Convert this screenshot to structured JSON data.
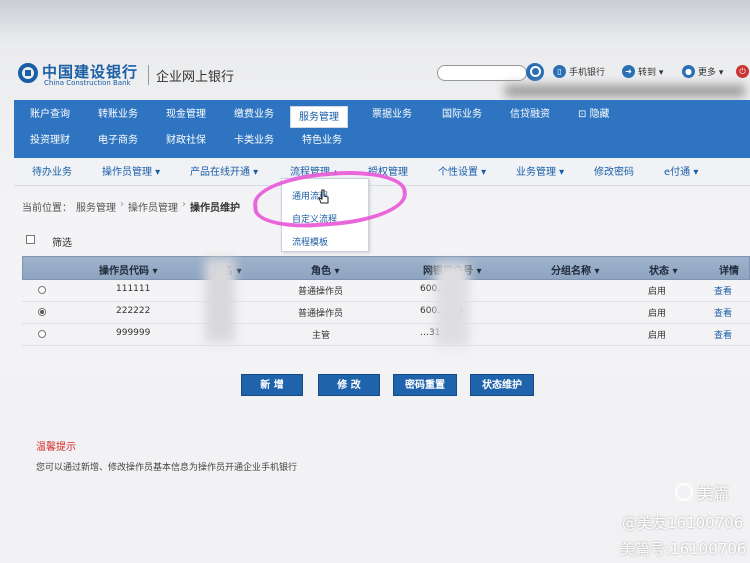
{
  "brand": {
    "name_cn": "中国建设银行",
    "name_en": "China Construction Bank",
    "product": "企业网上银行"
  },
  "toolbar": {
    "mobile_bank": "手机银行",
    "goto": "转到 ▾",
    "more": "更多 ▾"
  },
  "nav1": {
    "row1": [
      "账户查询",
      "转账业务",
      "现金管理",
      "缴费业务",
      "服务管理",
      "票据业务",
      "国际业务",
      "信贷融资",
      "隐藏"
    ],
    "row2": [
      "投资理财",
      "电子商务",
      "财政社保",
      "卡类业务",
      "特色业务"
    ],
    "active": "服务管理"
  },
  "nav2": [
    "待办业务",
    "操作员管理 ▾",
    "产品在线开通 ▾",
    "流程管理 ▴",
    "授权管理",
    "个性设置 ▾",
    "业务管理 ▾",
    "修改密码",
    "e付通 ▾"
  ],
  "dropdown": [
    "通用流程",
    "自定义流程",
    "流程模板"
  ],
  "breadcrumb": {
    "prefix": "当前位置：",
    "items": [
      "服务管理",
      "操作员管理"
    ],
    "current": "操作员维护"
  },
  "filter_label": "筛选",
  "table": {
    "headers": [
      "操作员代码 ▾",
      "姓名 ▾",
      "角色 ▾",
      "网银用户号 ▾",
      "分组名称 ▾",
      "状态 ▾",
      "详情"
    ],
    "rows": [
      {
        "code": "111111",
        "role": "普通操作员",
        "user_no": "600…2",
        "status": "启用",
        "detail": "查看",
        "selected": false
      },
      {
        "code": "222222",
        "role": "普通操作员",
        "user_no": "600…333",
        "status": "启用",
        "detail": "查看",
        "selected": true
      },
      {
        "code": "999999",
        "role": "主管",
        "user_no": "…31",
        "status": "启用",
        "detail": "查看",
        "selected": false
      }
    ]
  },
  "buttons": [
    "新 增",
    "修 改",
    "密码重置",
    "状态维护"
  ],
  "tip": {
    "title": "温馨提示",
    "text": "您可以通过新增、修改操作员基本信息为操作员开通企业手机银行"
  },
  "watermark": {
    "logo": "美篇",
    "line1": "@美友16100706",
    "line2": "美篇号:16100706"
  },
  "colors": {
    "nav_blue": "#2e74c1",
    "button_blue": "#1f63ad",
    "highlight_pink": "#e85fd8",
    "tip_red": "#d42a2a"
  }
}
